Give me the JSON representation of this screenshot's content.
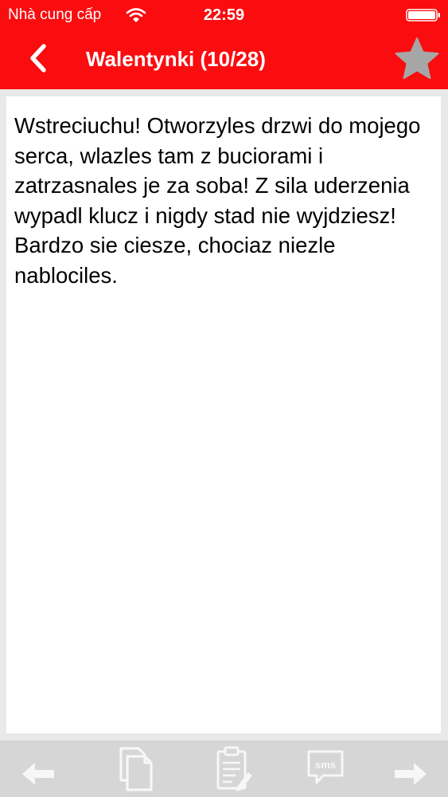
{
  "status_bar": {
    "carrier": "Nhà cung cấp",
    "time": "22:59"
  },
  "nav": {
    "title": "Walentynki (10/28)",
    "back_icon": "chevron-left-icon",
    "favorite_icon": "star-icon"
  },
  "message": {
    "text": "Wstreciuchu! Otworzyles drzwi do mojego serca, wlazles tam z buciorami i zatrzasnales je za soba! Z sila uderzenia wypadl klucz i nigdy stad nie wyjdziesz! Bardzo sie ciesze, chociaz niezle nablociles."
  },
  "toolbar": {
    "items": [
      {
        "icon": "arrow-left-icon"
      },
      {
        "icon": "copy-icon"
      },
      {
        "icon": "clipboard-edit-icon"
      },
      {
        "icon": "sms-icon",
        "label": "sms"
      },
      {
        "icon": "arrow-right-icon"
      }
    ]
  },
  "colors": {
    "header": "#fa0c0f",
    "background": "#e9e9e9",
    "toolbar": "#d6d6d6",
    "toolbar_icon": "#f7f7f7",
    "favorite_star": "#a6a6a6"
  }
}
